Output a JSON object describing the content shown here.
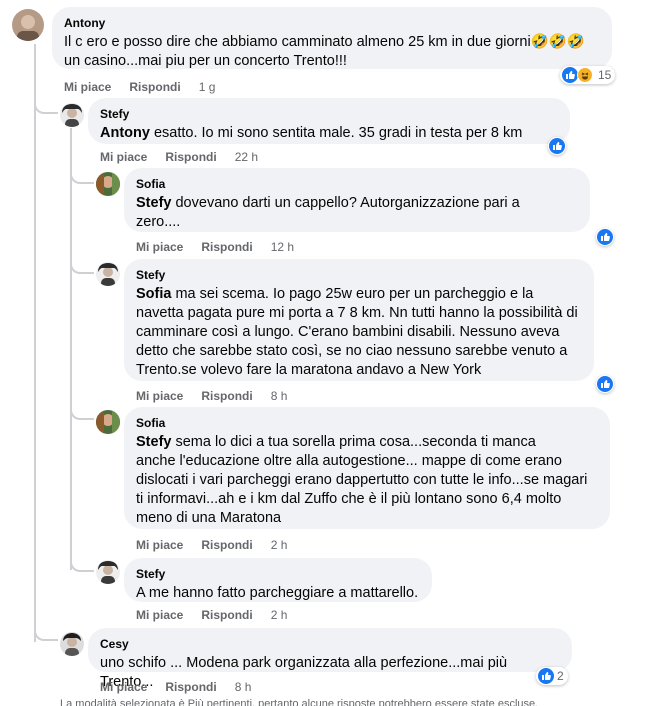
{
  "comments": [
    {
      "author": "Antony",
      "text_a": "Il c ero e posso dire che abbiamo camminato almeno 25 km in due giorni",
      "emojis": "🤣🤣🤣",
      "text_b": " un casino...mai piu per un concerto Trento!!!",
      "like": "Mi piace",
      "reply": "Rispondi",
      "time": "1 g",
      "reactions": "15"
    },
    {
      "author": "Stefy",
      "mention": "Antony",
      "text": " esatto. Io mi sono sentita male. 35 gradi in testa per 8 km",
      "like": "Mi piace",
      "reply": "Rispondi",
      "time": "22 h"
    },
    {
      "author": "Sofia",
      "mention": "Stefy",
      "text_a": " dovevano darti un cappello? Autorganizzazione pari a",
      "text_b": "zero....",
      "like": "Mi piace",
      "reply": "Rispondi",
      "time": "12 h"
    },
    {
      "author": "Stefy",
      "mention": "Sofia",
      "text_a": " ma sei scema. Io pago 25w euro per un parcheggio e la",
      "text_b": "navetta pagata pure mi porta a 7 8 km. Nn tutti hanno la possibilità di camminare così a lungo. C'erano bambini disabili. Nessuno aveva detto che sarebbe stato così, se no ciao nessuno sarebbe venuto a Trento.se volevo fare la maratona andavo a New York",
      "like": "Mi piace",
      "reply": "Rispondi",
      "time": "8 h"
    },
    {
      "author": "Sofia",
      "mention": "Stefy",
      "text_a": " sema lo dici a tua sorella prima cosa...seconda ti manca",
      "text_b": "anche l'educazione oltre alla autogestione... mappe di come erano dislocati i vari parcheggi erano dappertutto con tutte le info...se magari ti informavi...ah e i km dal Zuffo che è il più lontano sono 6,4 molto meno di una Maratona",
      "like": "Mi piace",
      "reply": "Rispondi",
      "time": "2 h"
    },
    {
      "author": "Stefy",
      "text": "A me hanno fatto parcheggiare a mattarello.",
      "like": "Mi piace",
      "reply": "Rispondi",
      "time": "2 h"
    },
    {
      "author": "Cesy",
      "text": "uno schifo ... Modena park organizzata alla perfezione...mai più Trento...",
      "like": "Mi piace",
      "reply": "Rispondi",
      "time": "8 h",
      "reactions": "2"
    }
  ],
  "footer": "La modalità selezionata è Più pertinenti, pertanto alcune risposte potrebbero essere state escluse.",
  "colors": {
    "bubble": "#f0f2f5",
    "like_blue": "#1877f2",
    "meta_gray": "#65676b"
  },
  "icons": [
    "like-icon",
    "haha-icon"
  ]
}
